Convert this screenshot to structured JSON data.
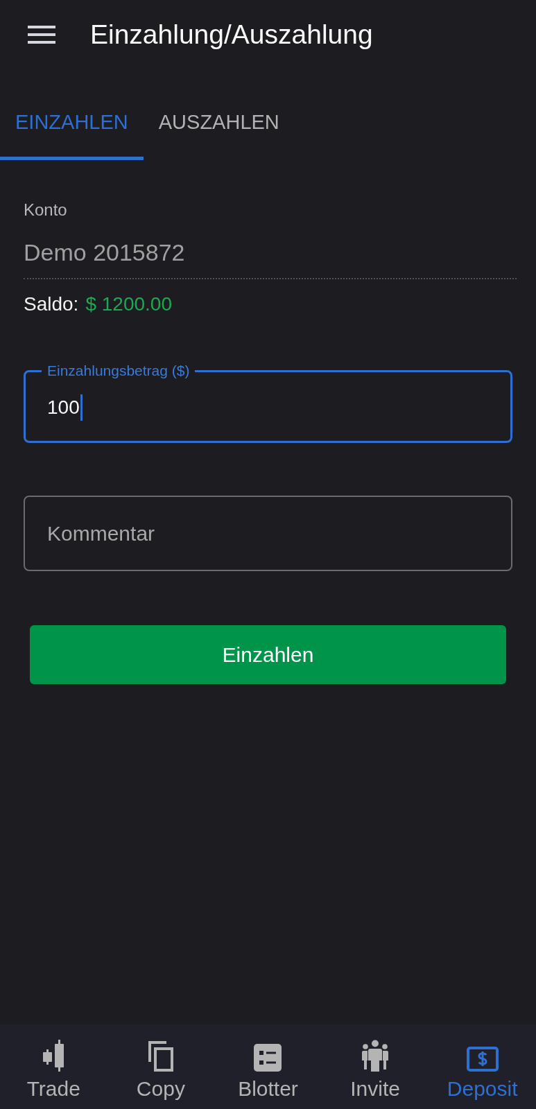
{
  "header": {
    "title": "Einzahlung/Auszahlung"
  },
  "tabs": [
    {
      "label": "EINZAHLEN",
      "selected": true
    },
    {
      "label": "AUSZAHLEN",
      "selected": false
    }
  ],
  "account": {
    "label": "Konto",
    "value": "Demo 2015872"
  },
  "balance": {
    "label": "Saldo:",
    "value": "$ 1200.00"
  },
  "amount_field": {
    "label": "Einzahlungsbetrag ($)",
    "value": "100",
    "focused": true
  },
  "comment_field": {
    "placeholder": "Kommentar"
  },
  "submit_button": {
    "label": "Einzahlen"
  },
  "bottom_nav": [
    {
      "label": "Trade",
      "kind": "candlestick",
      "selected": false
    },
    {
      "label": "Copy",
      "kind": "copy",
      "selected": false
    },
    {
      "label": "Blotter",
      "kind": "list",
      "selected": false
    },
    {
      "label": "Invite",
      "kind": "people",
      "selected": false
    },
    {
      "label": "Deposit",
      "kind": "dollar",
      "selected": true
    }
  ]
}
